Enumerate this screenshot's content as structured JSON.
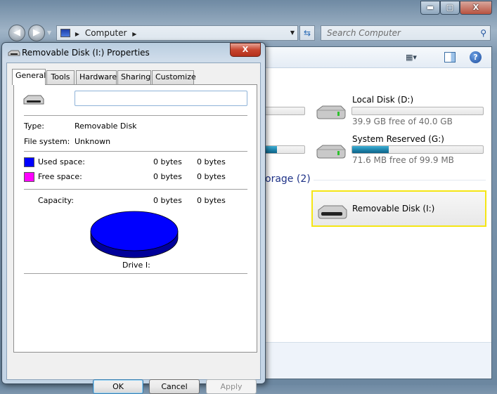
{
  "window_controls": {
    "minimize": "▬",
    "maximize": "▢",
    "close": "X"
  },
  "nav": {
    "back_icon": "back-arrow",
    "forward_icon": "forward-arrow"
  },
  "address": {
    "crumb": "Computer"
  },
  "search": {
    "placeholder": "Search Computer"
  },
  "explorer": {
    "drives": [
      {
        "name": "Local Disk (D:)",
        "free_text": "39.9 GB free of 40.0 GB",
        "used_fraction": 0.0
      },
      {
        "name": "System Reserved (G:)",
        "free_text": "71.6 MB free of 99.9 MB",
        "used_fraction": 0.28
      }
    ],
    "partial_used_fractions": [
      0.0,
      0.35
    ],
    "group_heading": "orage (2)",
    "removable": {
      "name": "Removable Disk (I:)",
      "highlight_color": "#f5e614"
    }
  },
  "dialog": {
    "title": "Removable Disk (I:) Properties",
    "close": "X",
    "tabs": [
      "General",
      "Tools",
      "Hardware",
      "Sharing",
      "Customize"
    ],
    "active_tab": "General",
    "label_value": "",
    "type_label": "Type:",
    "type_value": "Removable Disk",
    "fs_label": "File system:",
    "fs_value": "Unknown",
    "used_label": "Used space:",
    "used_bytes": "0 bytes",
    "used_size": "0 bytes",
    "used_color": "#0000ff",
    "free_label": "Free space:",
    "free_bytes": "0 bytes",
    "free_size": "0 bytes",
    "free_color": "#ff00ff",
    "capacity_label": "Capacity:",
    "capacity_bytes": "0 bytes",
    "capacity_size": "0 bytes",
    "drive_caption": "Drive I:",
    "buttons": {
      "ok": "OK",
      "cancel": "Cancel",
      "apply": "Apply"
    }
  }
}
